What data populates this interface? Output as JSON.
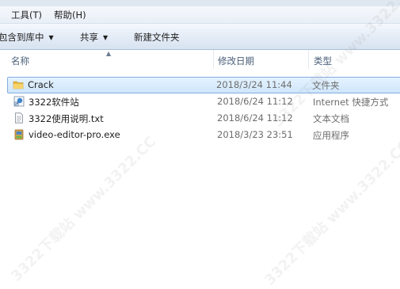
{
  "menu": {
    "tools": "工具(T)",
    "help": "帮助(H)"
  },
  "toolbar": {
    "include_library": "包含到库中",
    "share": "共享",
    "new_folder": "新建文件夹",
    "dropdown_arrow": "▼"
  },
  "columns": {
    "name": "名称",
    "date": "修改日期",
    "type": "类型",
    "sort_indicator": "▲"
  },
  "files": [
    {
      "name": "Crack",
      "date": "2018/3/24 11:44",
      "type": "文件夹",
      "icon": "folder-icon",
      "selected": true
    },
    {
      "name": "3322软件站",
      "date": "2018/6/24 11:12",
      "type": "Internet 快捷方式",
      "icon": "internet-shortcut-icon",
      "selected": false
    },
    {
      "name": "3322使用说明.txt",
      "date": "2018/6/24 11:12",
      "type": "文本文档",
      "icon": "text-document-icon",
      "selected": false
    },
    {
      "name": "video-editor-pro.exe",
      "date": "2018/3/23 23:51",
      "type": "应用程序",
      "icon": "application-icon",
      "selected": false
    }
  ],
  "watermark": "3322下载站 www.3322.CC",
  "colors": {
    "selection": "#cfe6fb",
    "selection_border": "#84acdd",
    "header_text": "#4c607a",
    "folder": "#e8b83f"
  }
}
